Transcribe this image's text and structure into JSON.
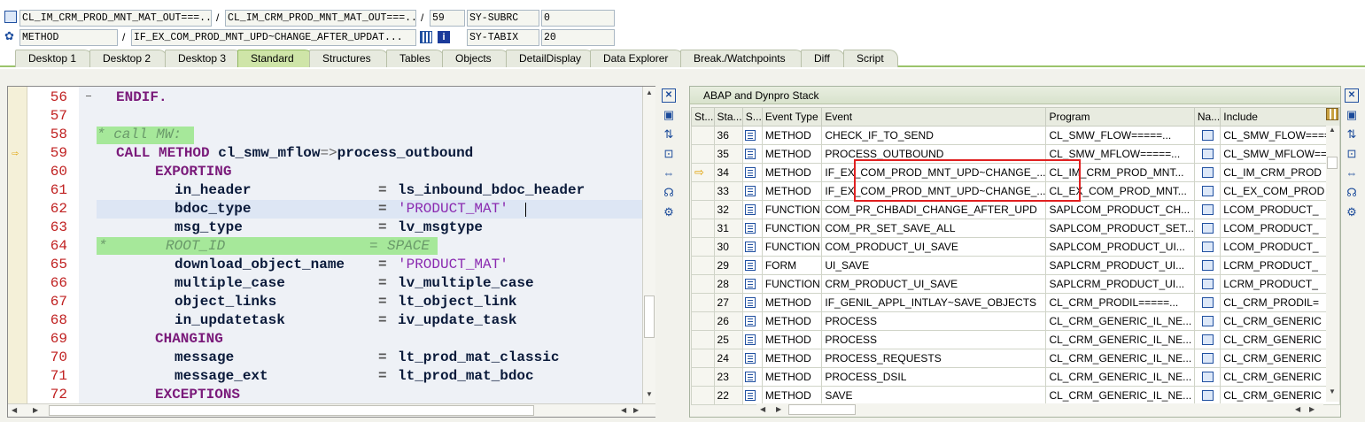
{
  "header": {
    "row1": {
      "class_name": "CL_IM_CRM_PROD_MNT_MAT_OUT===...",
      "include": "CL_IM_CRM_PROD_MNT_MAT_OUT===...",
      "line": "59",
      "sysvar_name": "SY-SUBRC",
      "sysvar_value": "0"
    },
    "row2": {
      "type": "METHOD",
      "method": "IF_EX_COM_PROD_MNT_UPD~CHANGE_AFTER_UPDAT...",
      "sysvar_name": "SY-TABIX",
      "sysvar_value": "20"
    },
    "separator": "/"
  },
  "tabs": [
    "Desktop 1",
    "Desktop 2",
    "Desktop 3",
    "Standard",
    "Structures",
    "Tables",
    "Objects",
    "DetailDisplay",
    "Data Explorer",
    "Break./Watchpoints",
    "Diff",
    "Script"
  ],
  "active_tab": "Standard",
  "code": {
    "lines": [
      {
        "n": "56",
        "text": "ENDIF."
      },
      {
        "n": "57",
        "text": ""
      },
      {
        "n": "58",
        "text": "* call MW:"
      },
      {
        "n": "59",
        "text": "CALL METHOD cl_smw_mflow=>process_outbound"
      },
      {
        "n": "60",
        "text": "EXPORTING"
      },
      {
        "n": "61",
        "text": "in_header",
        "value": "ls_inbound_bdoc_header"
      },
      {
        "n": "62",
        "text": "bdoc_type",
        "value": "'PRODUCT_MAT'"
      },
      {
        "n": "63",
        "text": "msg_type",
        "value": "lv_msgtype"
      },
      {
        "n": "64",
        "text": "ROOT_ID",
        "value": "SPACE"
      },
      {
        "n": "65",
        "text": "download_object_name",
        "value": "'PRODUCT_MAT'"
      },
      {
        "n": "66",
        "text": "multiple_case",
        "value": "lv_multiple_case"
      },
      {
        "n": "67",
        "text": "object_links",
        "value": "lt_object_link"
      },
      {
        "n": "68",
        "text": "in_updatetask",
        "value": "iv_update_task"
      },
      {
        "n": "69",
        "text": "CHANGING"
      },
      {
        "n": "70",
        "text": "message",
        "value": "lt_prod_mat_classic"
      },
      {
        "n": "71",
        "text": "message_ext",
        "value": "lt_prod_mat_bdoc"
      },
      {
        "n": "72",
        "text": "EXCEPTIONS"
      }
    ],
    "star": "*",
    "eq": "=",
    "kw_call_method": "CALL METHOD",
    "call_target": "cl_smw_mflow",
    "call_arrow": "=>",
    "call_method": "process_outbound"
  },
  "stack": {
    "title": "ABAP and Dynpro Stack",
    "columns": [
      "St...",
      "Sta...",
      "S...",
      "Event Type",
      "Event",
      "Program",
      "Na...",
      "Include"
    ],
    "rows": [
      {
        "level": "36",
        "type": "METHOD",
        "event": "CHECK_IF_TO_SEND",
        "program": "CL_SMW_FLOW=====...",
        "include": "CL_SMW_FLOW====="
      },
      {
        "level": "35",
        "type": "METHOD",
        "event": "PROCESS_OUTBOUND",
        "program": "CL_SMW_MFLOW=====...",
        "include": "CL_SMW_MFLOW===="
      },
      {
        "level": "34",
        "type": "METHOD",
        "event": "IF_EX_COM_PROD_MNT_UPD~CHANGE_...",
        "program": "CL_IM_CRM_PROD_MNT...",
        "include": "CL_IM_CRM_PROD",
        "current": true
      },
      {
        "level": "33",
        "type": "METHOD",
        "event": "IF_EX_COM_PROD_MNT_UPD~CHANGE_...",
        "program": "CL_EX_COM_PROD_MNT...",
        "include": "CL_EX_COM_PROD"
      },
      {
        "level": "32",
        "type": "FUNCTION",
        "event": "COM_PR_CHBADI_CHANGE_AFTER_UPD",
        "program": "SAPLCOM_PRODUCT_CH...",
        "include": "LCOM_PRODUCT_"
      },
      {
        "level": "31",
        "type": "FUNCTION",
        "event": "COM_PR_SET_SAVE_ALL",
        "program": "SAPLCOM_PRODUCT_SET...",
        "include": "LCOM_PRODUCT_"
      },
      {
        "level": "30",
        "type": "FUNCTION",
        "event": "COM_PRODUCT_UI_SAVE",
        "program": "SAPLCOM_PRODUCT_UI...",
        "include": "LCOM_PRODUCT_"
      },
      {
        "level": "29",
        "type": "FORM",
        "event": "UI_SAVE",
        "program": "SAPLCRM_PRODUCT_UI...",
        "include": "LCRM_PRODUCT_"
      },
      {
        "level": "28",
        "type": "FUNCTION",
        "event": "CRM_PRODUCT_UI_SAVE",
        "program": "SAPLCRM_PRODUCT_UI...",
        "include": "LCRM_PRODUCT_"
      },
      {
        "level": "27",
        "type": "METHOD",
        "event": "IF_GENIL_APPL_INTLAY~SAVE_OBJECTS",
        "program": "CL_CRM_PRODIL=====...",
        "include": "CL_CRM_PRODIL="
      },
      {
        "level": "26",
        "type": "METHOD",
        "event": "PROCESS",
        "program": "CL_CRM_GENERIC_IL_NE...",
        "include": "CL_CRM_GENERIC"
      },
      {
        "level": "25",
        "type": "METHOD",
        "event": "PROCESS",
        "program": "CL_CRM_GENERIC_IL_NE...",
        "include": "CL_CRM_GENERIC"
      },
      {
        "level": "24",
        "type": "METHOD",
        "event": "PROCESS_REQUESTS",
        "program": "CL_CRM_GENERIC_IL_NE...",
        "include": "CL_CRM_GENERIC"
      },
      {
        "level": "23",
        "type": "METHOD",
        "event": "PROCESS_DSIL",
        "program": "CL_CRM_GENERIC_IL_NE...",
        "include": "CL_CRM_GENERIC"
      },
      {
        "level": "22",
        "type": "METHOD",
        "event": "SAVE",
        "program": "CL_CRM_GENERIC_IL_NE...",
        "include": "CL_CRM_GENERIC"
      }
    ]
  },
  "colors": {
    "accent": "#9bc46b",
    "highlight_box": "#e02020",
    "line_numbers": "#c02020",
    "keyword": "#7a1a7a"
  }
}
